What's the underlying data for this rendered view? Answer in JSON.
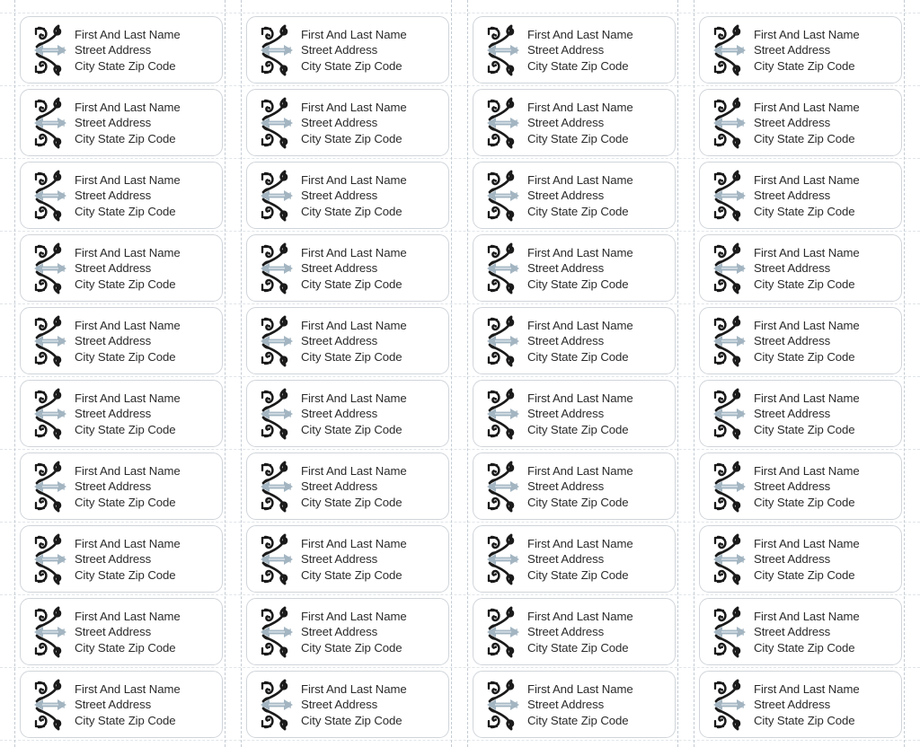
{
  "sheet": {
    "title": "Address Label Sheet",
    "columns": 4,
    "rows": 10,
    "label_border_color": "#d0d5da",
    "guide_color": "#b9c2cc",
    "background_color": "#ffffff"
  },
  "ornament": {
    "name": "decorative-scroll-flourish",
    "scroll_color": "#1a1a1a",
    "band_color": "#9fb2bf",
    "band_highlight_color": "#cfdae2"
  },
  "label": {
    "lines": [
      "First And Last Name",
      "Street Address",
      "City State Zip Code"
    ],
    "text_color": "#2b2b2b"
  },
  "labels": [
    {
      "id": "r1c1",
      "lines": [
        "First And Last Name",
        "Street Address",
        "City State Zip Code"
      ]
    },
    {
      "id": "r1c2",
      "lines": [
        "First And Last Name",
        "Street Address",
        "City State Zip Code"
      ]
    },
    {
      "id": "r1c3",
      "lines": [
        "First And Last Name",
        "Street Address",
        "City State Zip Code"
      ]
    },
    {
      "id": "r1c4",
      "lines": [
        "First And Last Name",
        "Street Address",
        "City State Zip Code"
      ]
    },
    {
      "id": "r2c1",
      "lines": [
        "First And Last Name",
        "Street Address",
        "City State Zip Code"
      ]
    },
    {
      "id": "r2c2",
      "lines": [
        "First And Last Name",
        "Street Address",
        "City State Zip Code"
      ]
    },
    {
      "id": "r2c3",
      "lines": [
        "First And Last Name",
        "Street Address",
        "City State Zip Code"
      ]
    },
    {
      "id": "r2c4",
      "lines": [
        "First And Last Name",
        "Street Address",
        "City State Zip Code"
      ]
    },
    {
      "id": "r3c1",
      "lines": [
        "First And Last Name",
        "Street Address",
        "City State Zip Code"
      ]
    },
    {
      "id": "r3c2",
      "lines": [
        "First And Last Name",
        "Street Address",
        "City State Zip Code"
      ]
    },
    {
      "id": "r3c3",
      "lines": [
        "First And Last Name",
        "Street Address",
        "City State Zip Code"
      ]
    },
    {
      "id": "r3c4",
      "lines": [
        "First And Last Name",
        "Street Address",
        "City State Zip Code"
      ]
    },
    {
      "id": "r4c1",
      "lines": [
        "First And Last Name",
        "Street Address",
        "City State Zip Code"
      ]
    },
    {
      "id": "r4c2",
      "lines": [
        "First And Last Name",
        "Street Address",
        "City State Zip Code"
      ]
    },
    {
      "id": "r4c3",
      "lines": [
        "First And Last Name",
        "Street Address",
        "City State Zip Code"
      ]
    },
    {
      "id": "r4c4",
      "lines": [
        "First And Last Name",
        "Street Address",
        "City State Zip Code"
      ]
    },
    {
      "id": "r5c1",
      "lines": [
        "First And Last Name",
        "Street Address",
        "City State Zip Code"
      ]
    },
    {
      "id": "r5c2",
      "lines": [
        "First And Last Name",
        "Street Address",
        "City State Zip Code"
      ]
    },
    {
      "id": "r5c3",
      "lines": [
        "First And Last Name",
        "Street Address",
        "City State Zip Code"
      ]
    },
    {
      "id": "r5c4",
      "lines": [
        "First And Last Name",
        "Street Address",
        "City State Zip Code"
      ]
    },
    {
      "id": "r6c1",
      "lines": [
        "First And Last Name",
        "Street Address",
        "City State Zip Code"
      ]
    },
    {
      "id": "r6c2",
      "lines": [
        "First And Last Name",
        "Street Address",
        "City State Zip Code"
      ]
    },
    {
      "id": "r6c3",
      "lines": [
        "First And Last Name",
        "Street Address",
        "City State Zip Code"
      ]
    },
    {
      "id": "r6c4",
      "lines": [
        "First And Last Name",
        "Street Address",
        "City State Zip Code"
      ]
    },
    {
      "id": "r7c1",
      "lines": [
        "First And Last Name",
        "Street Address",
        "City State Zip Code"
      ]
    },
    {
      "id": "r7c2",
      "lines": [
        "First And Last Name",
        "Street Address",
        "City State Zip Code"
      ]
    },
    {
      "id": "r7c3",
      "lines": [
        "First And Last Name",
        "Street Address",
        "City State Zip Code"
      ]
    },
    {
      "id": "r7c4",
      "lines": [
        "First And Last Name",
        "Street Address",
        "City State Zip Code"
      ]
    },
    {
      "id": "r8c1",
      "lines": [
        "First And Last Name",
        "Street Address",
        "City State Zip Code"
      ]
    },
    {
      "id": "r8c2",
      "lines": [
        "First And Last Name",
        "Street Address",
        "City State Zip Code"
      ]
    },
    {
      "id": "r8c3",
      "lines": [
        "First And Last Name",
        "Street Address",
        "City State Zip Code"
      ]
    },
    {
      "id": "r8c4",
      "lines": [
        "First And Last Name",
        "Street Address",
        "City State Zip Code"
      ]
    },
    {
      "id": "r9c1",
      "lines": [
        "First And Last Name",
        "Street Address",
        "City State Zip Code"
      ]
    },
    {
      "id": "r9c2",
      "lines": [
        "First And Last Name",
        "Street Address",
        "City State Zip Code"
      ]
    },
    {
      "id": "r9c3",
      "lines": [
        "First And Last Name",
        "Street Address",
        "City State Zip Code"
      ]
    },
    {
      "id": "r9c4",
      "lines": [
        "First And Last Name",
        "Street Address",
        "City State Zip Code"
      ]
    },
    {
      "id": "r10c1",
      "lines": [
        "First And Last Name",
        "Street Address",
        "City State Zip Code"
      ]
    },
    {
      "id": "r10c2",
      "lines": [
        "First And Last Name",
        "Street Address",
        "City State Zip Code"
      ]
    },
    {
      "id": "r10c3",
      "lines": [
        "First And Last Name",
        "Street Address",
        "City State Zip Code"
      ]
    },
    {
      "id": "r10c4",
      "lines": [
        "First And Last Name",
        "Street Address",
        "City State Zip Code"
      ]
    }
  ],
  "layout": {
    "column_x": [
      22,
      274,
      526,
      778
    ],
    "row_y": [
      18,
      99,
      180,
      261,
      342,
      423,
      504,
      585,
      666,
      747
    ],
    "label_width": 226,
    "label_height": 75,
    "guide_x": [
      16,
      250,
      268,
      502,
      520,
      754,
      772,
      1006
    ],
    "guide_y": [
      14,
      95,
      176,
      257,
      338,
      419,
      500,
      581,
      662,
      743,
      824
    ]
  }
}
